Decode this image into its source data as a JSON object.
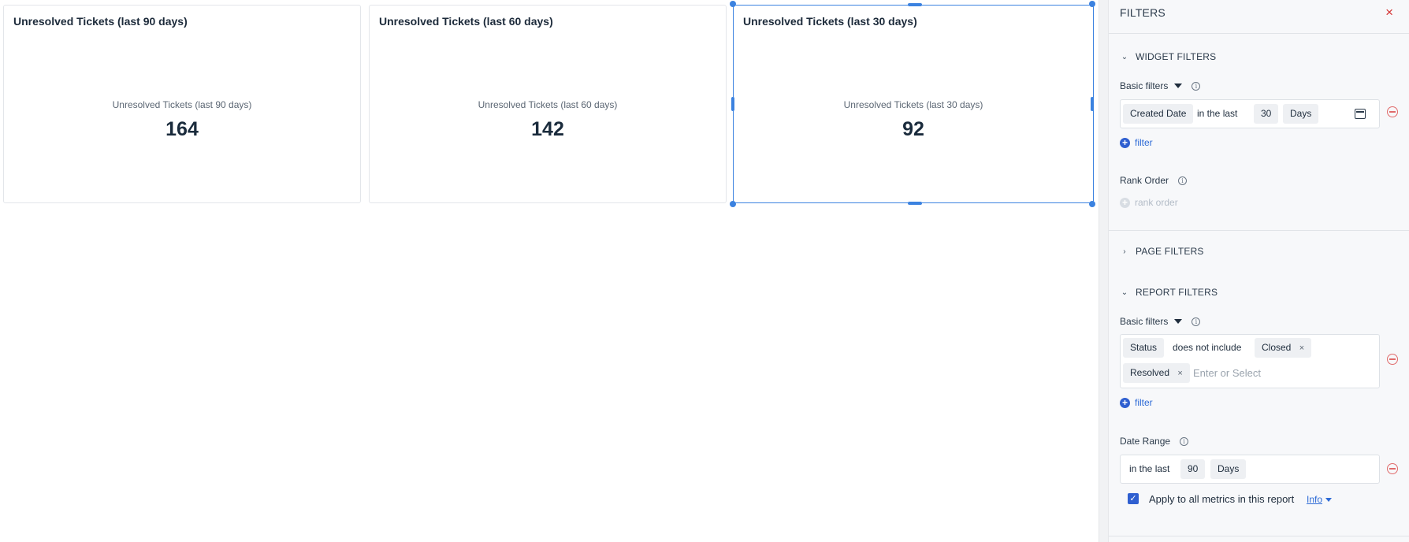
{
  "widgets": [
    {
      "title": "Unresolved Tickets (last 90 days)",
      "metric_label": "Unresolved Tickets (last 90 days)",
      "value": "164"
    },
    {
      "title": "Unresolved Tickets (last 60 days)",
      "metric_label": "Unresolved Tickets (last 60 days)",
      "value": "142"
    },
    {
      "title": "Unresolved Tickets (last 30 days)",
      "metric_label": "Unresolved Tickets (last 30 days)",
      "value": "92"
    }
  ],
  "panel": {
    "title": "FILTERS",
    "close_icon": "×",
    "widget_filters": {
      "heading": "WIDGET FILTERS",
      "basic_filters_label": "Basic filters",
      "filter": {
        "field": "Created Date",
        "operator": "in the last",
        "amount": "30",
        "unit": "Days"
      },
      "add_filter_label": "filter",
      "rank_order_label": "Rank Order",
      "add_rank_order_label": "rank order"
    },
    "page_filters": {
      "heading": "PAGE FILTERS"
    },
    "report_filters": {
      "heading": "REPORT FILTERS",
      "basic_filters_label": "Basic filters",
      "filter": {
        "field": "Status",
        "operator": "does not include",
        "values": [
          "Closed",
          "Resolved"
        ],
        "remove_value_icon": "×",
        "placeholder": "Enter or Select"
      },
      "add_filter_label": "filter",
      "date_range": {
        "label": "Date Range",
        "operator": "in the last",
        "amount": "90",
        "unit": "Days"
      },
      "apply_all_label": "Apply to all metrics in this report",
      "apply_all_checked": true,
      "info_link": "Info"
    }
  },
  "colors": {
    "accent": "#3b82e0",
    "link": "#2e6bd6",
    "danger": "#d32f2f"
  }
}
